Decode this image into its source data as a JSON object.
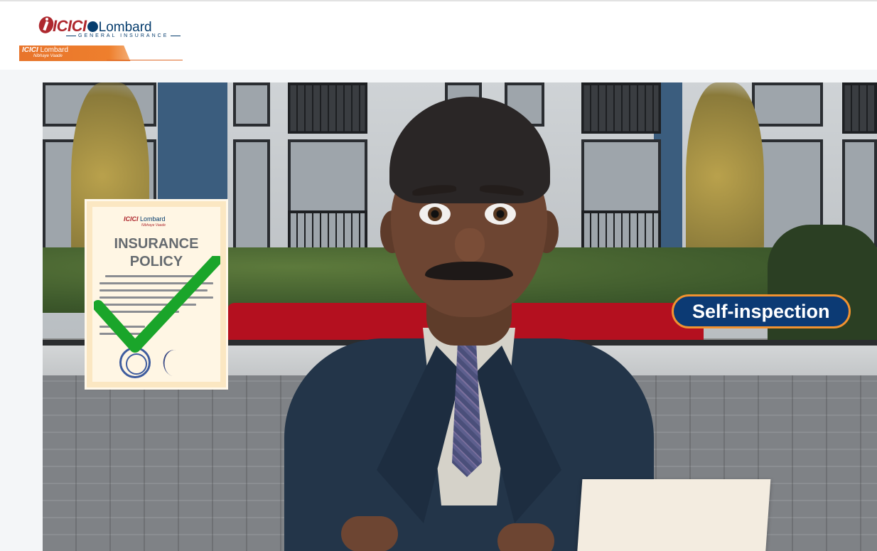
{
  "header": {
    "logo": {
      "brand_icici": "ICICI",
      "brand_lombard": "Lombard",
      "subtitle": "GENERAL INSURANCE"
    },
    "banner": {
      "brand_icici": "ICICI",
      "brand_lombard": "Lombard",
      "tagline": "Nibhaye Vaade"
    }
  },
  "video": {
    "document_card": {
      "logo_icici": "ICICI",
      "logo_lombard": "Lombard",
      "logo_tagline": "Nibhaye Vaade",
      "title_line1": "INSURANCE",
      "title_line2": "POLICY"
    },
    "caption_pill": "Self-inspection"
  },
  "colors": {
    "brand_red": "#ae282e",
    "brand_blue": "#053c6d",
    "accent_orange": "#f19230",
    "pill_blue": "#0c3a74",
    "check_green": "#1aa52a"
  }
}
